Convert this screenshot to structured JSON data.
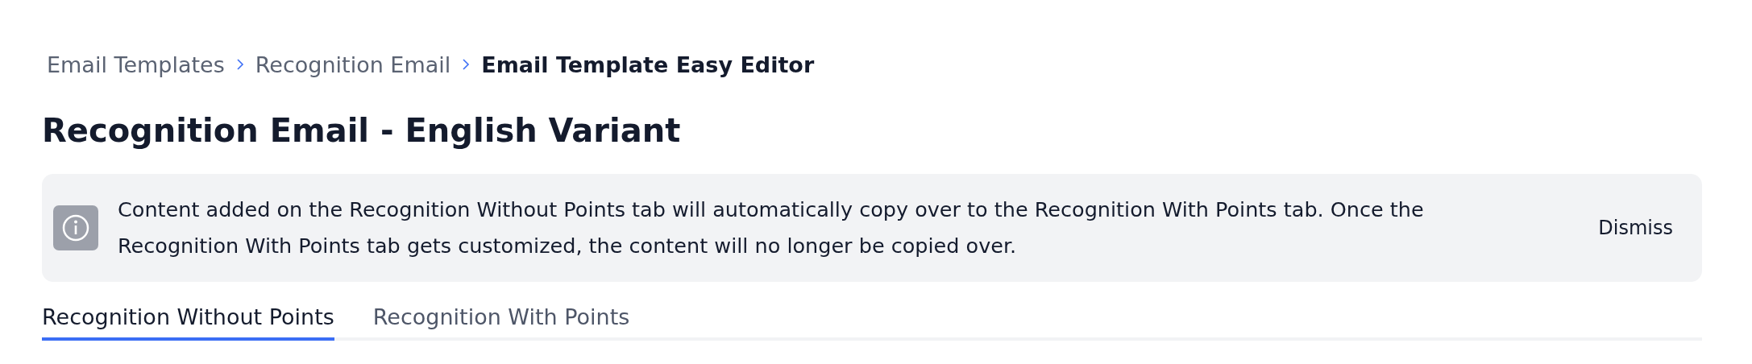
{
  "breadcrumb": [
    {
      "label": "Email Templates",
      "current": false
    },
    {
      "label": "Recognition Email",
      "current": false
    },
    {
      "label": "Email Template Easy Editor",
      "current": true
    }
  ],
  "title": "Recognition Email - English Variant",
  "notice": {
    "message": "Content added on the Recognition Without Points tab will automatically copy over to the Recognition With Points tab. Once the Recognition With Points tab gets customized, the content will no longer be copied over.",
    "dismiss": "Dismiss"
  },
  "tabs": [
    {
      "label": "Recognition Without Points",
      "selected": true
    },
    {
      "label": "Recognition With Points",
      "selected": false
    }
  ]
}
